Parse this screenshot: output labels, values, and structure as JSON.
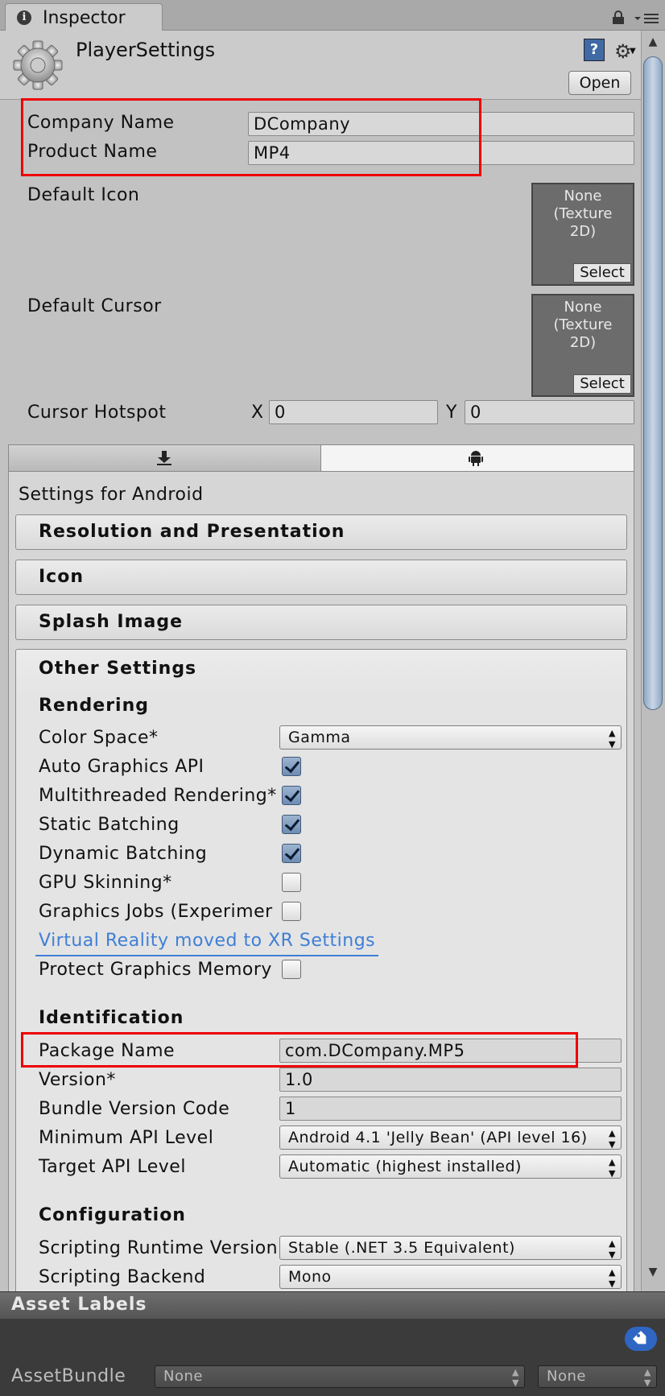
{
  "window": {
    "tab_label": "Inspector",
    "tab_info_glyph": "i"
  },
  "header": {
    "title": "PlayerSettings",
    "help_glyph": "?",
    "gear_glyph": "⚙",
    "open_label": "Open"
  },
  "general": {
    "company_name_label": "Company Name",
    "company_name_value": "DCompany",
    "product_name_label": "Product Name",
    "product_name_value": "MP4",
    "default_icon_label": "Default Icon",
    "default_icon_slot_text": "None\n(Texture\n2D)",
    "default_icon_select": "Select",
    "default_cursor_label": "Default Cursor",
    "default_cursor_slot_text": "None\n(Texture\n2D)",
    "default_cursor_select": "Select",
    "cursor_hotspot_label": "Cursor Hotspot",
    "hotspot_x_label": "X",
    "hotspot_x_value": "0",
    "hotspot_y_label": "Y",
    "hotspot_y_value": "0"
  },
  "platform": {
    "settings_for": "Settings for Android",
    "foldouts": {
      "resolution": "Resolution and Presentation",
      "icon": "Icon",
      "splash": "Splash Image",
      "other": "Other Settings"
    }
  },
  "rendering": {
    "heading": "Rendering",
    "color_space_label": "Color Space*",
    "color_space_value": "Gamma",
    "auto_graphics_label": "Auto Graphics API",
    "multithreaded_label": "Multithreaded Rendering*",
    "static_batching_label": "Static Batching",
    "dynamic_batching_label": "Dynamic Batching",
    "gpu_skinning_label": "GPU Skinning*",
    "graphics_jobs_label": "Graphics Jobs (Experimer",
    "vr_link": "Virtual Reality moved to XR Settings",
    "protect_memory_label": "Protect Graphics Memory"
  },
  "identification": {
    "heading": "Identification",
    "package_name_label": "Package Name",
    "package_name_value": "com.DCompany.MP5",
    "version_label": "Version*",
    "version_value": "1.0",
    "bundle_code_label": "Bundle Version Code",
    "bundle_code_value": "1",
    "min_api_label": "Minimum API Level",
    "min_api_value": "Android 4.1 'Jelly Bean' (API level 16)",
    "target_api_label": "Target API Level",
    "target_api_value": "Automatic (highest installed)"
  },
  "configuration": {
    "heading": "Configuration",
    "runtime_label": "Scripting Runtime Version",
    "runtime_value": "Stable (.NET 3.5 Equivalent)",
    "backend_label": "Scripting Backend",
    "backend_value": "Mono"
  },
  "asset_labels": {
    "title": "Asset Labels",
    "assetbundle_label": "AssetBundle",
    "assetbundle_value": "None",
    "variant_value": "None"
  },
  "colors": {
    "highlight_box": "#e00000",
    "link": "#3f7fd6",
    "tag": "#2f66c4"
  }
}
